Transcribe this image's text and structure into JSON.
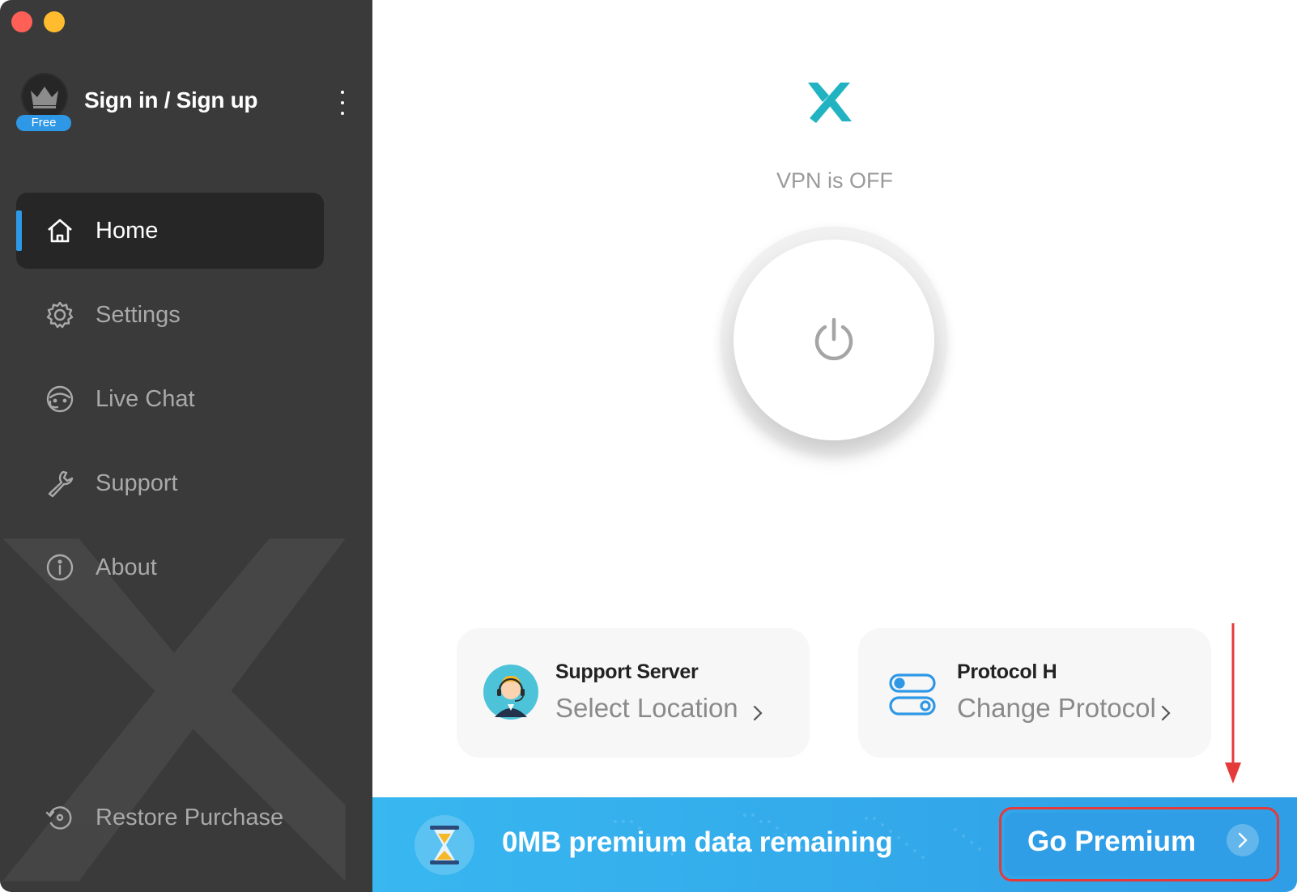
{
  "window": {
    "controls": [
      "close",
      "minimize"
    ]
  },
  "user": {
    "name": "Sign in / Sign up",
    "badge": "Free",
    "avatar_icon": "crown-icon",
    "menu_icon": "more-vertical-icon"
  },
  "nav": {
    "items": [
      {
        "label": "Home",
        "icon": "home-icon",
        "active": true
      },
      {
        "label": "Settings",
        "icon": "gear-icon",
        "active": false
      },
      {
        "label": "Live Chat",
        "icon": "live-chat-icon",
        "active": false
      },
      {
        "label": "Support",
        "icon": "wrench-icon",
        "active": false
      },
      {
        "label": "About",
        "icon": "info-icon",
        "active": false
      }
    ],
    "restore": {
      "label": "Restore Purchase",
      "icon": "restore-icon"
    }
  },
  "main": {
    "status": "VPN is OFF",
    "power_icon": "power-icon",
    "cards": {
      "server": {
        "title": "Support Server",
        "subtitle": "Select Location",
        "icon": "support-agent-icon"
      },
      "protocol": {
        "title": "Protocol H",
        "subtitle": "Change Protocol",
        "icon": "toggles-icon"
      }
    }
  },
  "banner": {
    "text": "0MB premium data remaining",
    "button_label": "Go Premium",
    "icon": "hourglass-icon"
  },
  "colors": {
    "sidebar_bg": "#3a3a3a",
    "accent_blue": "#2e98e6",
    "logo_teal": "#22b3c2",
    "highlight_red": "#e53a3a"
  }
}
